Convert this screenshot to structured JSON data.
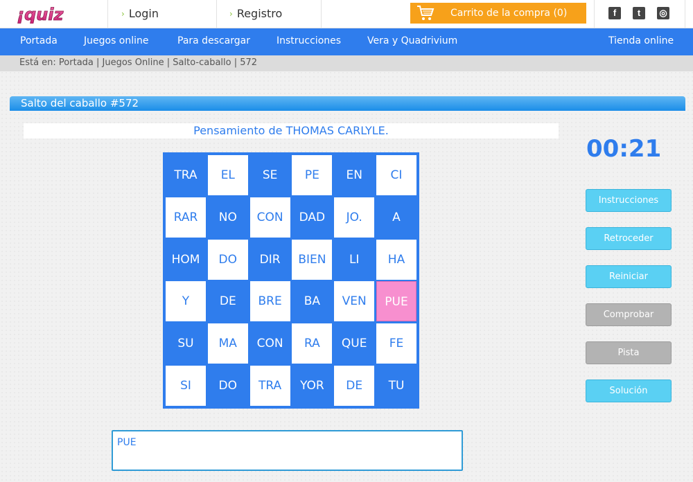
{
  "header": {
    "logo_text": "¡quiz",
    "login_label": "Login",
    "register_label": "Registro",
    "cart_label": "Carrito de la compra (0)",
    "social": [
      {
        "icon": "facebook-icon",
        "glyph": "f"
      },
      {
        "icon": "twitter-icon",
        "glyph": "t"
      },
      {
        "icon": "instagram-icon",
        "glyph": "◎"
      }
    ]
  },
  "nav": {
    "items": [
      "Portada",
      "Juegos online",
      "Para descargar",
      "Instrucciones",
      "Vera y Quadrivium"
    ],
    "shop_label": "Tienda online"
  },
  "breadcrumb": "Está en: Portada | Juegos Online | Salto-caballo | 572",
  "puzzle": {
    "title": "Salto del caballo #572",
    "thought": "Pensamiento de THOMAS CARLYLE.",
    "grid": [
      [
        "TRA",
        "EL",
        "SE",
        "PE",
        "EN",
        "CI"
      ],
      [
        "RAR",
        "NO",
        "CON",
        "DAD",
        "JO.",
        "A"
      ],
      [
        "HOM",
        "DO",
        "DIR",
        "BIEN",
        "LI",
        "HA"
      ],
      [
        "Y",
        "DE",
        "BRE",
        "BA",
        "VEN",
        "PUE"
      ],
      [
        "SU",
        "MA",
        "CON",
        "RA",
        "QUE",
        "FE"
      ],
      [
        "SI",
        "DO",
        "TRA",
        "YOR",
        "DE",
        "TU"
      ]
    ],
    "selected_cell": "PUE",
    "answer_text": "PUE"
  },
  "sidebar": {
    "timer": "00:21",
    "buttons": [
      {
        "label": "Instrucciones",
        "style": "cyan"
      },
      {
        "label": "Retroceder",
        "style": "cyan"
      },
      {
        "label": "Reiniciar",
        "style": "cyan"
      },
      {
        "label": "Comprobar",
        "style": "gray"
      },
      {
        "label": "Pista",
        "style": "gray"
      },
      {
        "label": "Solución",
        "style": "cyan"
      }
    ]
  },
  "colors": {
    "brand_blue": "#2f7ded",
    "cart_orange": "#f7a11a",
    "selected_pink": "#f78fcf",
    "button_cyan": "#5ad0f3",
    "button_gray": "#b3b3b3",
    "logo_pink": "#e8308a"
  }
}
